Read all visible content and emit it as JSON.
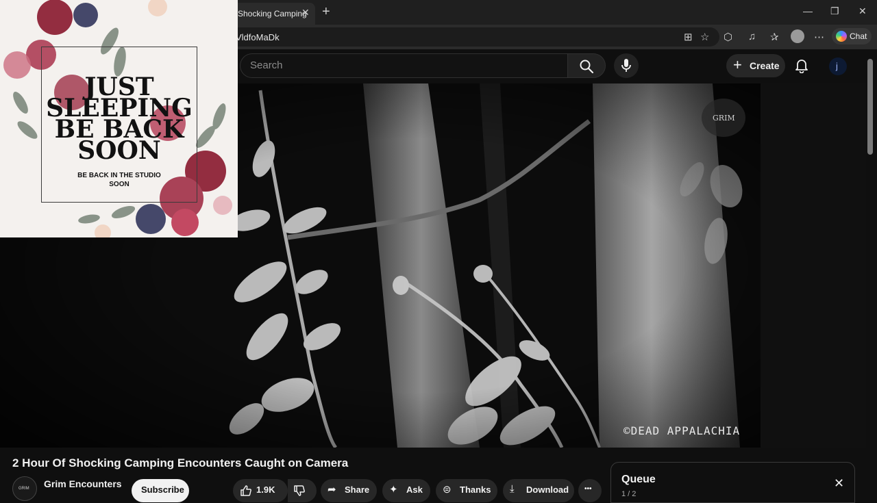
{
  "browser": {
    "tab_title": "Shocking Camping",
    "tab_close": "✕",
    "new_tab": "+",
    "url": "VldfoMaDk",
    "window_controls": [
      "—",
      "❐",
      "✕"
    ],
    "chat_label": "Chat"
  },
  "header": {
    "search_placeholder": "Search",
    "create_label": "Create",
    "avatar_letter": "j"
  },
  "overlay": {
    "title_lines": [
      "JUST",
      "SLEEPING",
      "BE BACK",
      "SOON"
    ],
    "subtitle_lines": [
      "BE BACK IN THE STUDIO",
      "SOON"
    ]
  },
  "video": {
    "watermark": "©DEAD APPALACHIA",
    "logo_text": "GRIM",
    "title": "2 Hour Of Shocking Camping Encounters Caught on Camera"
  },
  "channel": {
    "name": "Grim Encounters",
    "avatar_text": "GRIM",
    "subscribe_label": "Subscribe"
  },
  "actions": {
    "like_count": "1.9K",
    "share_label": "Share",
    "ask_label": "Ask",
    "thanks_label": "Thanks",
    "download_label": "Download",
    "more_label": "•••"
  },
  "queue": {
    "title": "Queue",
    "count": "1 / 2",
    "close": "✕"
  },
  "colors": {
    "page_bg": "#0f0f0f",
    "chip_bg": "#272727",
    "overlay_bg": "#f4f1ee",
    "flower_red": "#8e2236"
  }
}
